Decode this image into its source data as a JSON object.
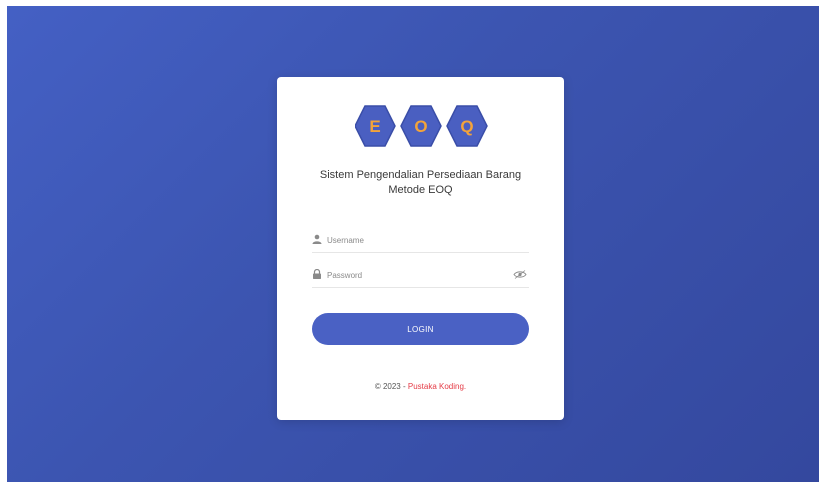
{
  "logo": {
    "letters": [
      "E",
      "O",
      "Q"
    ],
    "hex_color": "#4a5fc1",
    "letter_color": "#f3a33a"
  },
  "title_line1": "Sistem Pengendalian Persediaan Barang",
  "title_line2": "Metode EOQ",
  "username": {
    "placeholder": "Username",
    "value": "",
    "icon": "user-icon"
  },
  "password": {
    "placeholder": "Password",
    "value": "",
    "icon": "lock-icon",
    "toggle_icon": "eye-icon"
  },
  "login_label": "LOGIN",
  "footer": {
    "prefix": "© 2023 - ",
    "link_text": "Pustaka Koding."
  },
  "colors": {
    "background": "#3f58b6",
    "button": "#4a61c4",
    "link": "#e53b46"
  }
}
